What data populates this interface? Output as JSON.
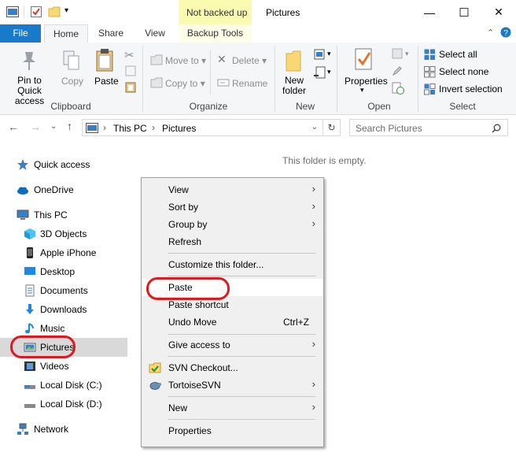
{
  "window": {
    "contextual_tab": "Not backed up",
    "title": "Pictures",
    "minimize": "—",
    "maximize": "☐",
    "close": "✕"
  },
  "tabs": [
    "File",
    "Home",
    "Share",
    "View",
    "Backup Tools"
  ],
  "ribbon": {
    "clipboard": {
      "pin": "Pin to Quick",
      "pin2": "access",
      "copy": "Copy",
      "paste": "Paste",
      "label": "Clipboard"
    },
    "organize": {
      "move_to": "Move to",
      "copy_to": "Copy to",
      "delete": "Delete",
      "rename": "Rename",
      "label": "Organize"
    },
    "new": {
      "new_folder": "New",
      "new_folder2": "folder",
      "label": "New"
    },
    "open": {
      "properties": "Properties",
      "label": "Open"
    },
    "select": {
      "all": "Select all",
      "none": "Select none",
      "invert": "Invert selection",
      "label": "Select"
    }
  },
  "nav": {
    "path": [
      "This PC",
      "Pictures"
    ],
    "search_placeholder": "Search Pictures"
  },
  "sidebar": [
    {
      "label": "Quick access",
      "icon": "star-icon"
    },
    {
      "label": "OneDrive",
      "icon": "cloud-icon"
    },
    {
      "label": "This PC",
      "icon": "computer-icon"
    },
    {
      "label": "3D Objects",
      "icon": "cube-icon"
    },
    {
      "label": "Apple iPhone",
      "icon": "phone-icon"
    },
    {
      "label": "Desktop",
      "icon": "desktop-icon"
    },
    {
      "label": "Documents",
      "icon": "document-icon"
    },
    {
      "label": "Downloads",
      "icon": "download-icon"
    },
    {
      "label": "Music",
      "icon": "music-icon"
    },
    {
      "label": "Pictures",
      "icon": "pictures-icon"
    },
    {
      "label": "Videos",
      "icon": "video-icon"
    },
    {
      "label": "Local Disk (C:)",
      "icon": "disk-icon"
    },
    {
      "label": "Local Disk (D:)",
      "icon": "disk-icon"
    },
    {
      "label": "Network",
      "icon": "network-icon"
    }
  ],
  "content": {
    "empty_message": "This folder is empty."
  },
  "context_menu": [
    {
      "label": "View",
      "submenu": true
    },
    {
      "label": "Sort by",
      "submenu": true
    },
    {
      "label": "Group by",
      "submenu": true
    },
    {
      "label": "Refresh"
    },
    {
      "label": "Customize this folder..."
    },
    {
      "label": "Paste"
    },
    {
      "label": "Paste shortcut"
    },
    {
      "label": "Undo Move",
      "shortcut": "Ctrl+Z"
    },
    {
      "label": "Give access to",
      "submenu": true
    },
    {
      "label": "SVN Checkout..."
    },
    {
      "label": "TortoiseSVN",
      "submenu": true
    },
    {
      "label": "New",
      "submenu": true
    },
    {
      "label": "Properties"
    }
  ],
  "colors": {
    "accent": "#1979ca",
    "highlight": "#e0191e",
    "contextual_tab": "#fafab1"
  }
}
